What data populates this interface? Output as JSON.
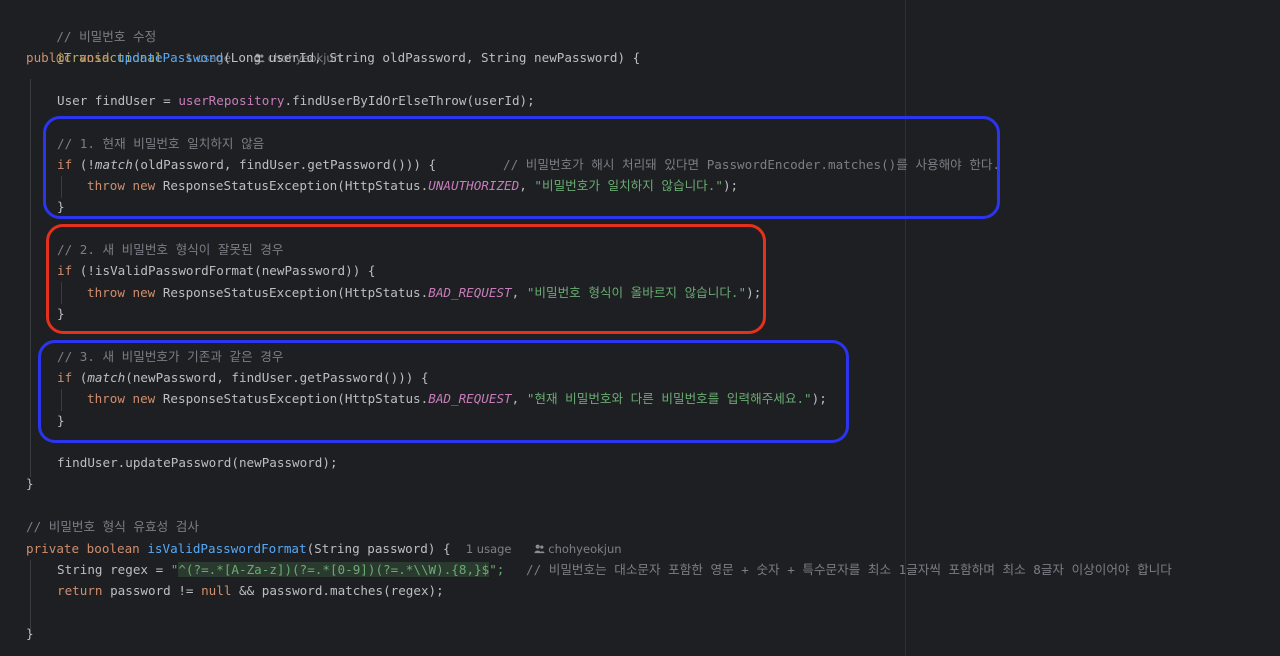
{
  "editor": {
    "inlay": {
      "usage_1": "1 usage",
      "author_1": "chohyeokjun",
      "usage_2": "1 usage",
      "author_2": "chohyeokjun"
    },
    "code": {
      "l0_comment": "// 비밀번호 수정",
      "l1_annotation": "@Transactional",
      "l2_public": "public",
      "l2_void": "void",
      "l2_fn": "updatePassword",
      "l2_params": "(Long userId, String oldPassword, String newPassword) {",
      "l3_type": "User findUser = ",
      "l3_repo": "userRepository",
      "l3_rest": ".findUserByIdOrElseThrow(userId);",
      "l4_comment": "// 1. 현재 비밀번호 일치하지 않음",
      "l5_if": "if",
      "l5_open": " (!",
      "l5_match": "match",
      "l5_args": "(oldPassword, findUser.getPassword())) {",
      "l5_comment": "// 비밀번호가 해시 처리돼 있다면 PasswordEncoder.matches()를 사용해야 한다.",
      "l6_throw": "throw",
      "l6_new": "new",
      "l6_cls": " ResponseStatusException(HttpStatus.",
      "l6_const": "UNAUTHORIZED",
      "l6_sep": ", ",
      "l6_str": "\"비밀번호가 일치하지 않습니다.\"",
      "l6_end": ");",
      "brace": "}",
      "l8_comment": "// 2. 새 비밀번호 형식이 잘못된 경우",
      "l9_if": "if",
      "l9_rest": " (!isValidPasswordFormat(newPassword)) {",
      "l10_throw": "throw",
      "l10_new": "new",
      "l10_cls": " ResponseStatusException(HttpStatus.",
      "l10_const": "BAD_REQUEST",
      "l10_sep": ", ",
      "l10_str": "\"비밀번호 형식이 올바르지 않습니다.\"",
      "l10_end": ");",
      "l12_comment": "// 3. 새 비밀번호가 기존과 같은 경우",
      "l13_if": "if",
      "l13_open": " (",
      "l13_match": "match",
      "l13_args": "(newPassword, findUser.getPassword())) {",
      "l14_throw": "throw",
      "l14_new": "new",
      "l14_cls": " ResponseStatusException(HttpStatus.",
      "l14_const": "BAD_REQUEST",
      "l14_sep": ", ",
      "l14_str": "\"현재 비밀번호와 다른 비밀번호를 입력해주세요.\"",
      "l14_end": ");",
      "l16_call": "findUser.updatePassword(newPassword);",
      "l18_comment": "// 비밀번호 형식 유효성 검사",
      "l19_private": "private",
      "l19_boolean": "boolean",
      "l19_fn": "isValidPasswordFormat",
      "l19_params": "(String password) {",
      "l20_decl": "String regex = ",
      "l20_q1": "\"",
      "l20_regex": "^(?=.*[A-Za-z])(?=.*[0-9])(?=.*\\\\W).{8,}$",
      "l20_q2": "\";",
      "l20_comment": "// 비밀번호는 대소문자 포함한 영문 + 숫자 + 특수문자를 최소 1글자씩 포함하며 최소 8글자 이상이어야 합니다",
      "l21_return": "return",
      "l21_mid": " password != ",
      "l21_null": "null",
      "l21_end": " && password.matches(regex);"
    }
  }
}
